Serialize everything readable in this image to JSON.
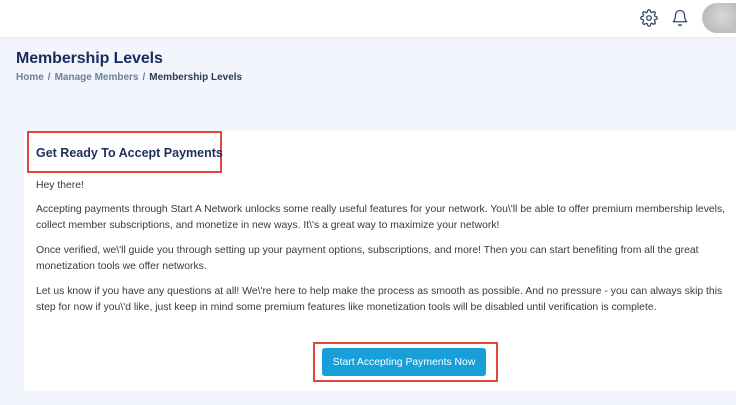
{
  "topbar": {
    "icons": [
      "gear-icon",
      "bell-icon"
    ]
  },
  "header": {
    "title": "Membership Levels",
    "breadcrumb": [
      "Home",
      "Manage Members",
      "Membership Levels"
    ],
    "breadcrumb_separator": "/"
  },
  "card": {
    "title": "Get Ready To Accept Payments",
    "paragraphs": [
      "Hey there!",
      "Accepting payments through Start A Network unlocks some really useful features for your network. You\\'ll be able to offer premium membership levels, collect member subscriptions, and monetize in new ways. It\\'s a great way to maximize your network!",
      "Once verified, we\\'ll guide you through setting up your payment options, subscriptions, and more! Then you can start benefiting from all the great monetization tools we offer networks.",
      "Let us know if you have any questions at all! We\\'re here to help make the process as smooth as possible. And no pressure - you can always skip this step for now if you\\'d like, just keep in mind some premium features like monetization tools will be disabled until verification is complete."
    ],
    "cta_label": "Start Accepting Payments Now"
  },
  "colors": {
    "highlight_border": "#e2473b",
    "button_bg": "#169fd8",
    "title_color": "#1a2c5b",
    "page_bg": "#f2f5fb"
  }
}
